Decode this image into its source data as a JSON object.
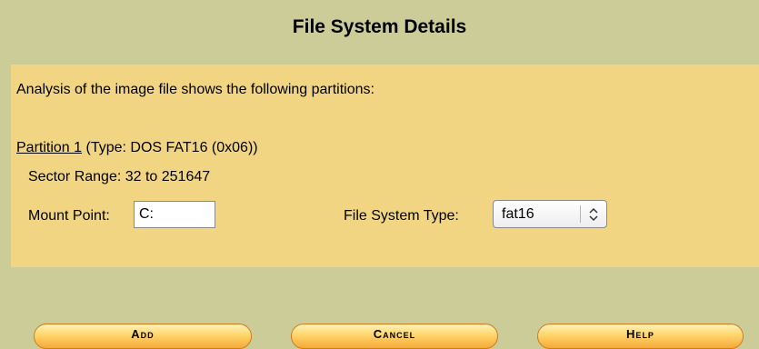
{
  "header": {
    "title": "File System Details"
  },
  "panel": {
    "intro": "Analysis of the image file shows the following partitions:",
    "partition": {
      "link": "Partition 1",
      "type": "(Type: DOS FAT16 (0x06))",
      "sector_range": "Sector Range: 32 to 251647",
      "mount_point_label": "Mount Point:",
      "mount_point_value": "C:",
      "fs_type_label": "File System Type:",
      "fs_type_value": "fat16"
    }
  },
  "buttons": {
    "add": "Add",
    "cancel": "Cancel",
    "help": "Help"
  },
  "colors": {
    "background": "#cccc99",
    "panel": "#f1d583",
    "button_border": "#d07a20"
  },
  "icons": {
    "select_arrow": "up-down-chevron-icon"
  }
}
